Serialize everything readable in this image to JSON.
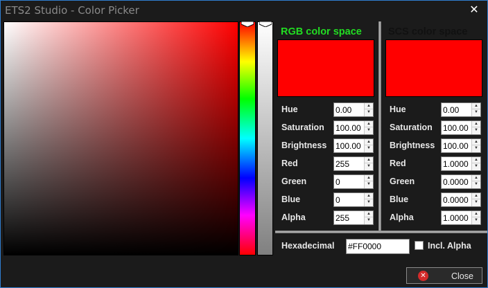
{
  "window": {
    "title": "ETS2 Studio - Color Picker"
  },
  "rgb_panel": {
    "title": "RGB color space",
    "title_color": "#22dd22",
    "preview_color": "#ff0000",
    "fields": [
      {
        "label": "Hue",
        "value": "0.00"
      },
      {
        "label": "Saturation",
        "value": "100.00"
      },
      {
        "label": "Brightness",
        "value": "100.00"
      },
      {
        "label": "Red",
        "value": "255"
      },
      {
        "label": "Green",
        "value": "0"
      },
      {
        "label": "Blue",
        "value": "0"
      },
      {
        "label": "Alpha",
        "value": "255"
      }
    ]
  },
  "scs_panel": {
    "title": "SCS color space",
    "title_color": "#111111",
    "preview_color": "#ff0000",
    "fields": [
      {
        "label": "Hue",
        "value": "0.00"
      },
      {
        "label": "Saturation",
        "value": "100.00"
      },
      {
        "label": "Brightness",
        "value": "100.00"
      },
      {
        "label": "Red",
        "value": "1.0000"
      },
      {
        "label": "Green",
        "value": "0.0000"
      },
      {
        "label": "Blue",
        "value": "0.0000"
      },
      {
        "label": "Alpha",
        "value": "1.0000"
      }
    ]
  },
  "hex": {
    "label": "Hexadecimal",
    "value": "#FF0000"
  },
  "incl_alpha": {
    "label": "Incl. Alpha",
    "checked": false
  },
  "buttons": {
    "close_label": "Close"
  },
  "icons": {
    "window_close": "close-icon",
    "close_button": "close-circle-icon",
    "spin_up": "arrow-up-icon",
    "spin_down": "arrow-down-icon"
  },
  "colors": {
    "selected_hue": "#ff0000",
    "window_bg": "#1b1b1b",
    "window_border": "#2f7fd1"
  }
}
